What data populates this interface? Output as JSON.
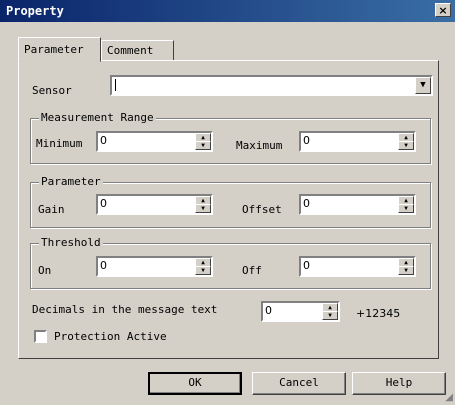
{
  "window": {
    "title": "Property",
    "close_glyph": "×"
  },
  "tabs": [
    {
      "label": "Parameter"
    },
    {
      "label": "Comment"
    }
  ],
  "sensor": {
    "label": "Sensor",
    "value": "",
    "dropdown_glyph": "▼"
  },
  "measurement_range": {
    "title": "Measurement Range",
    "min_label": "Minimum",
    "min_value": "0",
    "max_label": "Maximum",
    "max_value": "0"
  },
  "parameter": {
    "title": "Parameter",
    "gain_label": "Gain",
    "gain_value": "0",
    "offset_label": "Offset",
    "offset_value": "0"
  },
  "threshold": {
    "title": "Threshold",
    "on_label": "On",
    "on_value": "0",
    "off_label": "Off",
    "off_value": "0"
  },
  "decimals": {
    "label": "Decimals in the message text",
    "value": "0",
    "preview": "+12345"
  },
  "protection": {
    "label": "Protection Active",
    "checked": false
  },
  "buttons": {
    "ok": "OK",
    "cancel": "Cancel",
    "help": "Help"
  },
  "icons": {
    "spin_up": "▲",
    "spin_down": "▼",
    "grip": "◢"
  }
}
